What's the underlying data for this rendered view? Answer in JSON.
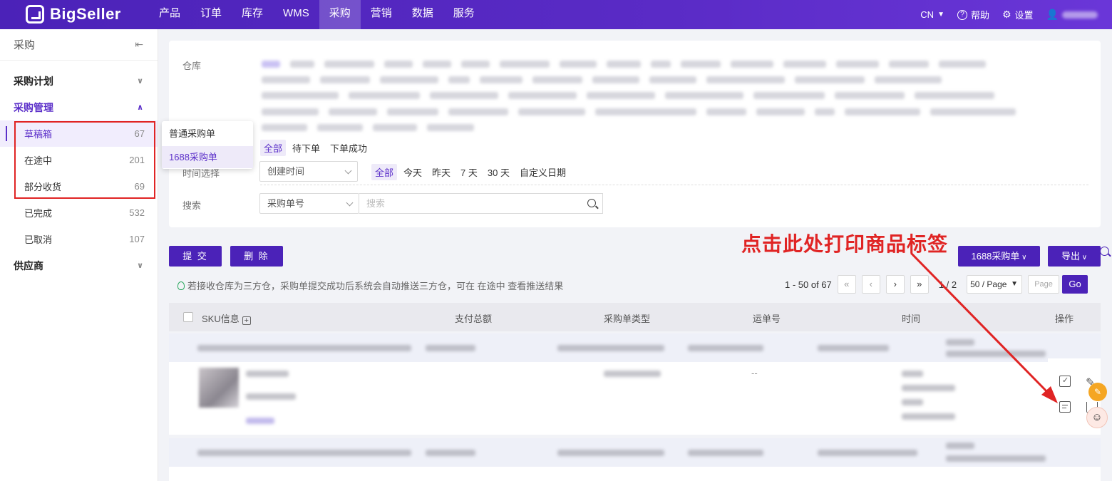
{
  "brand": {
    "logo_text": "BigSeller",
    "accent": "#4b22b8",
    "annotation_color": "#e02424"
  },
  "nav": {
    "items": [
      "产品",
      "订单",
      "库存",
      "WMS",
      "采购",
      "营销",
      "数据",
      "服务"
    ],
    "active": "采购",
    "lang": "CN",
    "help": "帮助",
    "settings": "设置"
  },
  "sidebar": {
    "title": "采购",
    "groups": {
      "plan": "采购计划",
      "manage": "采购管理",
      "supplier": "供应商"
    },
    "items": [
      {
        "label": "草稿箱",
        "count": "67"
      },
      {
        "label": "在途中",
        "count": "201"
      },
      {
        "label": "部分收货",
        "count": "69"
      },
      {
        "label": "已完成",
        "count": "532"
      },
      {
        "label": "已取消",
        "count": "107"
      }
    ]
  },
  "popup": {
    "items": [
      "普通采购单",
      "1688采购单"
    ],
    "selected": "1688采购单"
  },
  "filter": {
    "warehouse_label": "仓库",
    "status_tabs": [
      "全部",
      "待下单",
      "下单成功"
    ],
    "time_label": "时间选择",
    "time_select": "创建时间",
    "time_tabs": [
      "全部",
      "今天",
      "昨天",
      "7 天",
      "30 天",
      "自定义日期"
    ],
    "search_label": "搜索",
    "search_field": "采购单号",
    "search_placeholder": "搜索"
  },
  "actions": {
    "submit": "提 交",
    "delete": "删 除",
    "order_type": "1688采购单",
    "export": "导出"
  },
  "annotation": "点击此处打印商品标签",
  "tip": "若接收仓库为三方仓，采购单提交成功后系统会自动推送三方仓，可在 在途中 查看推送结果",
  "pagination": {
    "range": "1 - 50 of 67",
    "page": "1 / 2",
    "page_size": "50 / Page",
    "page_placeholder": "Page",
    "go": "Go"
  },
  "table": {
    "headers": {
      "sku": "SKU信息",
      "total": "支付总额",
      "type": "采购单类型",
      "waybill": "运单号",
      "time": "时间",
      "ops": "操作"
    },
    "row_waybill": "--"
  }
}
